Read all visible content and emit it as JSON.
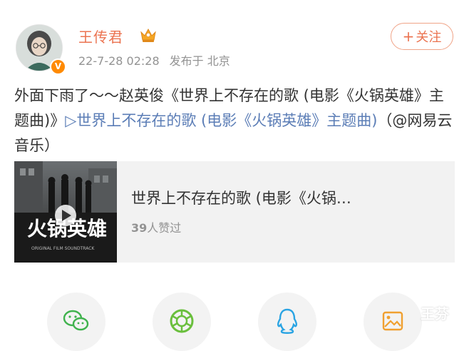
{
  "user": {
    "name": "王传君",
    "verified_badge": "V",
    "date": "22-7-28 02:28",
    "source": "发布于 北京"
  },
  "follow_button": {
    "plus": "+",
    "label": "关注"
  },
  "post": {
    "text_plain": "外面下雨了～～赵英俊《世界上不存在的歌 (电影《火锅英雄》主题曲)》",
    "link_text": "▷世界上不存在的歌 (电影《火锅英雄》主题曲)",
    "mention_text": "（@网易云音乐）"
  },
  "music_card": {
    "title": "世界上不存在的歌 (电影《火锅…",
    "likes_count": "39",
    "likes_label": "人赞过",
    "thumb_title": "火锅英雄",
    "thumb_subtitle": "ORIGINAL FILM SOUNDTRACK"
  },
  "share_icons": [
    "wechat-icon",
    "moments-icon",
    "qq-icon",
    "save-image-icon"
  ],
  "watermark": "王芬",
  "colors": {
    "accent": "#eb7350",
    "link": "#5b7db6",
    "meta": "#939393",
    "card_bg": "#f2f2f2"
  }
}
